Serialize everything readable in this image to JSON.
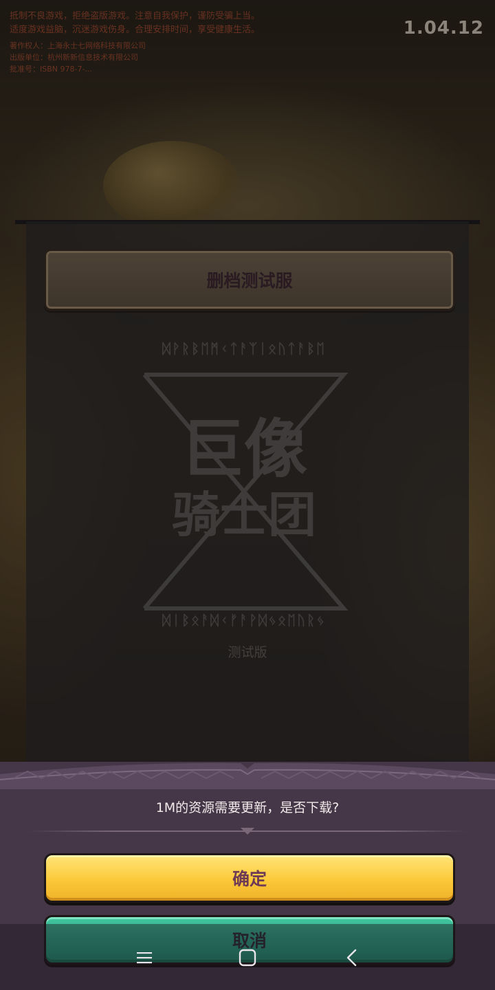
{
  "notice": {
    "lines": [
      "抵制不良游戏，拒绝盗版游戏。注意自我保护，谨防受骗上当。",
      "适度游戏益脑，沉迷游戏伤身。合理安排时间，享受健康生活。"
    ],
    "small_lines": [
      "著作权人：上海永士七网络科技有限公司",
      "出版单位：杭州新新信息技术有限公司",
      "批准号：ISBN 978-7-..."
    ]
  },
  "version": "1.04.12",
  "panel": {
    "title": "删档测试服",
    "logo_line1": "巨像",
    "logo_line2": "骑士团",
    "test_label": "测试版"
  },
  "dialog": {
    "message": "1M的资源需要更新，是否下载?",
    "confirm_label": "确定",
    "cancel_label": "取消"
  },
  "navbar": {
    "icons": [
      "menu-icon",
      "home-icon",
      "back-icon"
    ]
  },
  "colors": {
    "confirm": "#fbc93a",
    "cancel": "#2aa784",
    "dialog_bg": "#453747"
  }
}
